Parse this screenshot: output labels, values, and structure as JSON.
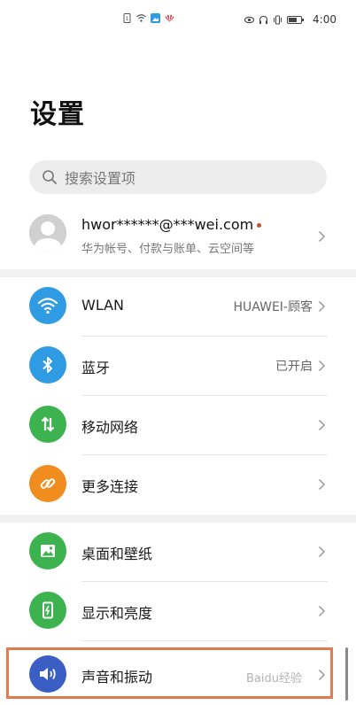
{
  "status_bar": {
    "time": "4:00",
    "left_icons": [
      "sim-icon",
      "wifi-icon",
      "gallery-icon",
      "huawei-icon"
    ],
    "right_icons": [
      "eye-icon",
      "headphone-icon",
      "vibrate-icon",
      "battery-icon"
    ]
  },
  "page": {
    "title": "设置"
  },
  "search": {
    "placeholder": "搜索设置项"
  },
  "account": {
    "name": "hwor******@***wei.com",
    "subtitle": "华为帐号、付款与账单、云空间等"
  },
  "group_connectivity": [
    {
      "label": "WLAN",
      "value": "HUAWEI-顾客",
      "icon": "wifi-icon",
      "color": "#2f9be2"
    },
    {
      "label": "蓝牙",
      "value": "已开启",
      "icon": "bluetooth-icon",
      "color": "#2f9be2"
    },
    {
      "label": "移动网络",
      "value": "",
      "icon": "mobile-network-icon",
      "color": "#3cb34f"
    },
    {
      "label": "更多连接",
      "value": "",
      "icon": "link-icon",
      "color": "#f08d1e"
    }
  ],
  "group_display": [
    {
      "label": "桌面和壁纸",
      "value": "",
      "icon": "wallpaper-icon",
      "color": "#3cb34f"
    },
    {
      "label": "显示和亮度",
      "value": "",
      "icon": "display-icon",
      "color": "#3cb34f"
    },
    {
      "label": "声音和振动",
      "value": "",
      "icon": "sound-icon",
      "color": "#3a5ec4"
    }
  ],
  "watermark": "Baidu经验"
}
